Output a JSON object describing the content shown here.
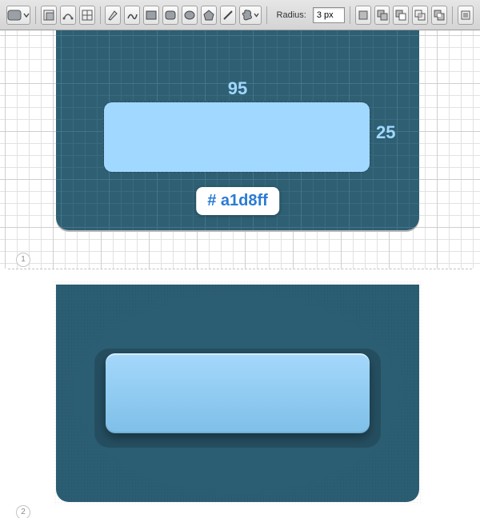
{
  "toolbar": {
    "radius_label": "Radius:",
    "radius_value": "3 px",
    "icons": {
      "fill": "fill-popup",
      "rect": "rectangle",
      "rounded": "rounded-rectangle",
      "square_small": "pixel-grid",
      "pen": "pen",
      "freeform": "freeform-pen",
      "shape_rect": "shape-rectangle",
      "shape_round": "shape-rounded-rectangle",
      "ellipse": "ellipse",
      "polygon": "polygon",
      "line": "line",
      "custom": "custom-shape",
      "align1": "path-new",
      "align2": "path-add",
      "align3": "path-subtract",
      "align4": "path-intersect",
      "align5": "path-exclude",
      "more": "panel-menu"
    }
  },
  "step1": {
    "badge": "1",
    "width_label": "95",
    "height_label": "25",
    "swatch": "# a1d8ff",
    "shape_fill": "#a1d8ff",
    "panel_bg": "#2e5f73"
  },
  "step2": {
    "badge": "2",
    "panel_bg": "#2c5e73",
    "shape_top": "#a5d8fb",
    "shape_bottom": "#7ebfe8"
  }
}
